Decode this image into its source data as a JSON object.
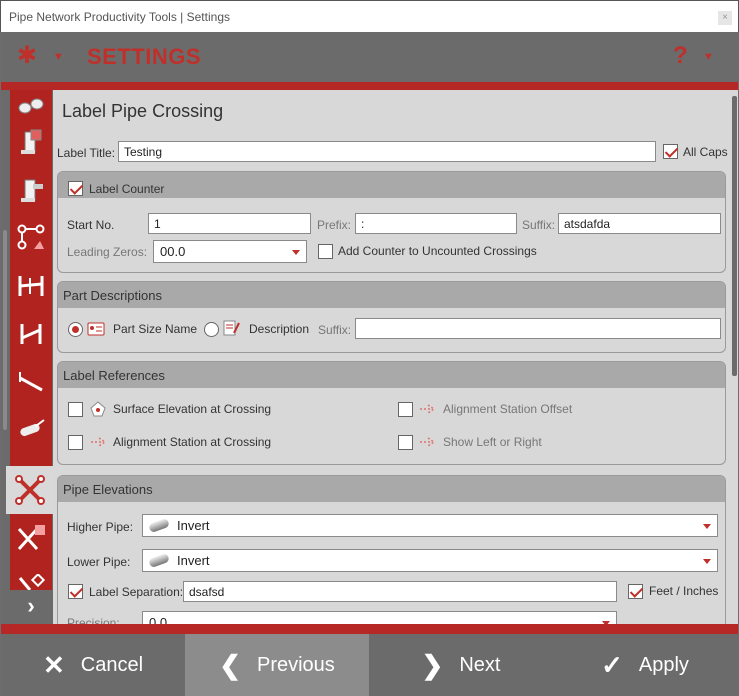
{
  "window": {
    "title": "Pipe Network Productivity Tools | Settings",
    "close": "×"
  },
  "header": {
    "title": "SETTINGS",
    "gear_icon": "gear-icon",
    "help": "?",
    "caret": "▼",
    "accent": "#c0302b"
  },
  "page": {
    "title": "Label Pipe Crossing"
  },
  "label_title": {
    "label": "Label Title:",
    "value": "Testing",
    "all_caps_label": "All Caps",
    "all_caps_checked": true
  },
  "label_counter": {
    "title": "Label Counter",
    "checked": true,
    "start_no_label": "Start No.",
    "start_no": "1",
    "prefix_label": "Prefix:",
    "prefix": ":",
    "suffix_label": "Suffix:",
    "suffix": "atsdafda",
    "leading_zeros_label": "Leading Zeros:",
    "leading_zeros": "00.0",
    "add_counter_label": "Add Counter to Uncounted Crossings",
    "add_counter_checked": false
  },
  "part_descriptions": {
    "title": "Part Descriptions",
    "part_size_name": "Part Size Name",
    "part_size_selected": true,
    "description": "Description",
    "suffix_label": "Suffix:",
    "suffix": ""
  },
  "label_references": {
    "title": "Label References",
    "surface_elevation": "Surface Elevation at Crossing",
    "alignment_station_offset": "Alignment Station Offset",
    "alignment_station": "Alignment Station at Crossing",
    "show_left_right": "Show Left or Right"
  },
  "pipe_elevations": {
    "title": "Pipe Elevations",
    "higher_pipe_label": "Higher Pipe:",
    "higher_pipe": "Invert",
    "lower_pipe_label": "Lower Pipe:",
    "lower_pipe": "Invert",
    "label_separation_label": "Label Separation:",
    "label_separation": "dsafsd",
    "label_separation_checked": true,
    "feet_inches_label": "Feet / Inches",
    "feet_inches_checked": true,
    "precision_label": "Precision:",
    "precision": "0.0"
  },
  "footer": {
    "cancel": "Cancel",
    "previous": "Previous",
    "next": "Next",
    "apply": "Apply"
  },
  "sidebar": {
    "expand": "›"
  }
}
